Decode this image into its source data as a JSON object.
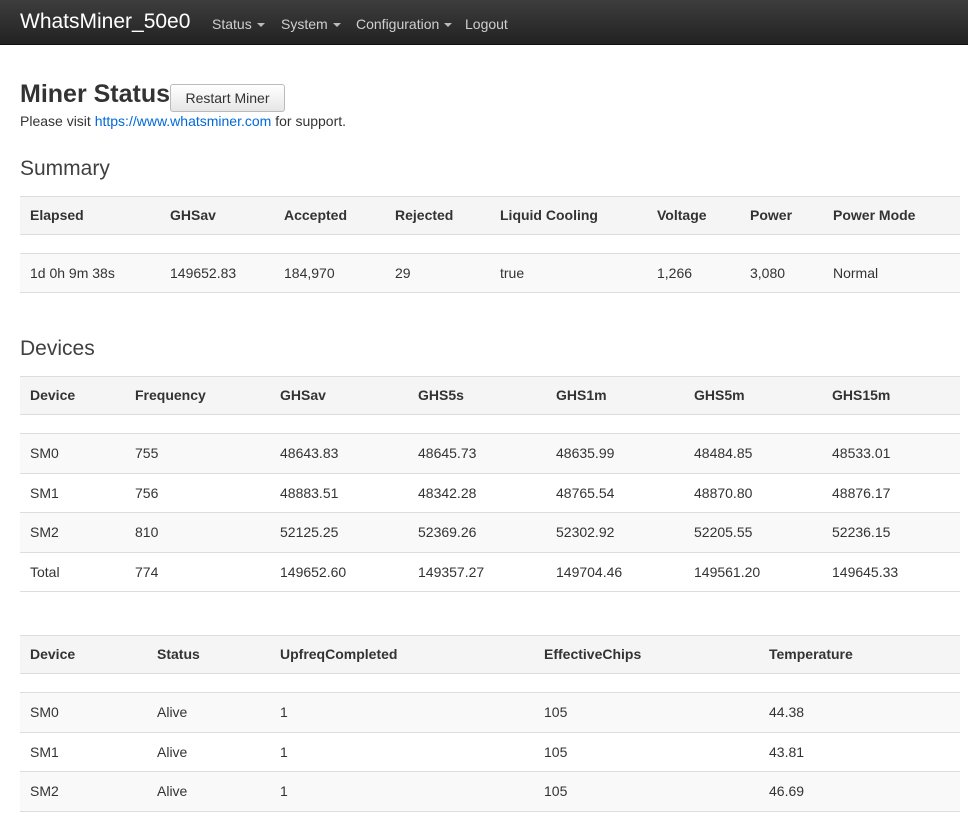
{
  "nav": {
    "brand": "WhatsMiner_50e0",
    "items": [
      {
        "label": "Status",
        "dropdown": true
      },
      {
        "label": "System",
        "dropdown": true
      },
      {
        "label": "Configuration",
        "dropdown": true
      },
      {
        "label": "Logout",
        "dropdown": false
      }
    ]
  },
  "page": {
    "title": "Miner Status",
    "restart_label": "Restart Miner",
    "support_prefix": "Please visit ",
    "support_link": "https://www.whatsminer.com",
    "support_suffix": " for support."
  },
  "summary": {
    "heading": "Summary",
    "headers": [
      "Elapsed",
      "GHSav",
      "Accepted",
      "Rejected",
      "Liquid Cooling",
      "Voltage",
      "Power",
      "Power Mode"
    ],
    "rows": [
      [
        "1d 0h 9m 38s",
        "149652.83",
        "184,970",
        "29",
        "true",
        "1,266",
        "3,080",
        "Normal"
      ]
    ]
  },
  "devices": {
    "heading": "Devices",
    "headers": [
      "Device",
      "Frequency",
      "GHSav",
      "GHS5s",
      "GHS1m",
      "GHS5m",
      "GHS15m"
    ],
    "rows": [
      [
        "SM0",
        "755",
        "48643.83",
        "48645.73",
        "48635.99",
        "48484.85",
        "48533.01"
      ],
      [
        "SM1",
        "756",
        "48883.51",
        "48342.28",
        "48765.54",
        "48870.80",
        "48876.17"
      ],
      [
        "SM2",
        "810",
        "52125.25",
        "52369.26",
        "52302.92",
        "52205.55",
        "52236.15"
      ],
      [
        "Total",
        "774",
        "149652.60",
        "149357.27",
        "149704.46",
        "149561.20",
        "149645.33"
      ]
    ]
  },
  "device_status": {
    "headers": [
      "Device",
      "Status",
      "UpfreqCompleted",
      "EffectiveChips",
      "Temperature"
    ],
    "rows": [
      [
        "SM0",
        "Alive",
        "1",
        "105",
        "44.38"
      ],
      [
        "SM1",
        "Alive",
        "1",
        "105",
        "43.81"
      ],
      [
        "SM2",
        "Alive",
        "1",
        "105",
        "46.69"
      ]
    ]
  }
}
